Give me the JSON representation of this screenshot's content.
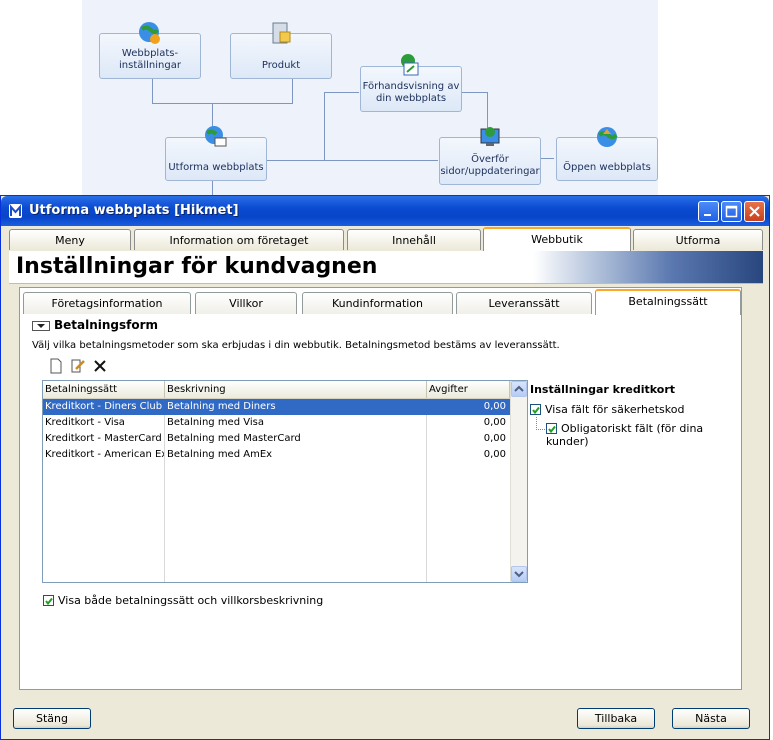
{
  "workflow": {
    "nodes": [
      {
        "label1": "Webbplats-",
        "label2": "inställningar"
      },
      {
        "label1": "",
        "label2": "Produkt"
      },
      {
        "label1": "Förhandsvisning av",
        "label2": "din webbplats"
      },
      {
        "label1": "",
        "label2": "Utforma webbplats"
      },
      {
        "label1": "Överför",
        "label2": "sidor/uppdateringar"
      },
      {
        "label1": "",
        "label2": "Öppen webbplats"
      }
    ]
  },
  "window": {
    "title": "Utforma webbplats [Hikmet]",
    "top_tabs": [
      "Meny",
      "Information om företaget",
      "Innehåll",
      "Webbutik",
      "Utforma"
    ],
    "header": "Inställningar för kundvagnen",
    "sub_tabs": [
      "Företagsinformation",
      "Villkor",
      "Kundinformation",
      "Leveranssätt",
      "Betalningssätt"
    ],
    "section_title": "Betalningsform",
    "description": "Välj vilka betalningsmetoder som ska erbjudas i din webbutik. Betalningsmetod bestäms av leveranssätt.",
    "grid": {
      "columns": [
        "Betalningssätt",
        "Beskrivning",
        "Avgifter"
      ],
      "rows": [
        [
          "Kreditkort - Diners Club",
          "Betalning med Diners",
          "0,00"
        ],
        [
          "Kreditkort - Visa",
          "Betalning med Visa",
          "0,00"
        ],
        [
          "Kreditkort - MasterCard",
          "Betalning med MasterCard",
          "0,00"
        ],
        [
          "Kreditkort - American Express",
          "Betalning med AmEx",
          "0,00"
        ]
      ]
    },
    "credit_settings": {
      "title": "Inställningar kreditkort",
      "show_security": "Visa fält för säkerhetskod",
      "mandatory": "Obligatoriskt fält (för dina kunder)"
    },
    "show_both": "Visa både betalningssätt och villkorsbeskrivning",
    "buttons": {
      "close": "Stäng",
      "back": "Tillbaka",
      "next": "Nästa"
    }
  }
}
